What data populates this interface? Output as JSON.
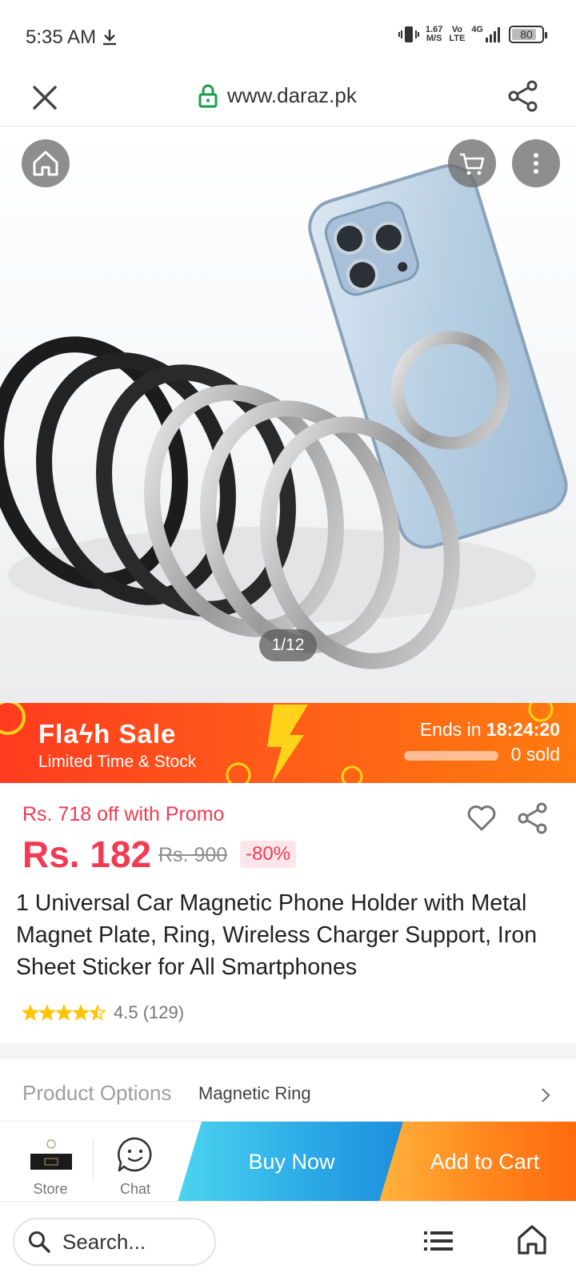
{
  "status_bar": {
    "time": "5:35 AM",
    "net_speed_value": "1.67",
    "net_speed_unit": "M/S",
    "volte_top": "Vo",
    "volte_bottom": "LTE",
    "network": "4G",
    "battery": "80",
    "icons": [
      "download-icon",
      "vibrate-icon",
      "signal-icon",
      "battery-icon"
    ]
  },
  "url_bar": {
    "url": "www.daraz.pk",
    "icons": [
      "close-icon",
      "lock-icon",
      "share-icon"
    ],
    "lock_color": "#1e9e4a"
  },
  "gallery": {
    "counter": "1/12",
    "icons": [
      "home-icon",
      "cart-icon",
      "more-vertical-icon"
    ]
  },
  "flash_sale": {
    "title": "Flaϟh Sale",
    "subtitle": "Limited Time & Stock",
    "ends_label": "Ends in",
    "ends_time": "18:24:20",
    "sold": "0 sold",
    "sold_progress": 0
  },
  "pricing": {
    "promo": "Rs. 718 off with Promo",
    "price": "Rs. 182",
    "original_price": "Rs. 900",
    "discount": "-80%",
    "accent_color": "#f23b53"
  },
  "product": {
    "title": "1 Universal Car Magnetic Phone Holder with Metal Magnet Plate, Ring, Wireless Charger Support, Iron Sheet Sticker for All Smartphones",
    "rating_value": 4.5,
    "rating_text": "4.5 (129)",
    "rating_count": "129"
  },
  "options": {
    "label": "Product Options",
    "value": "Magnetic Ring"
  },
  "action_bar": {
    "store_label": "Store",
    "chat_label": "Chat",
    "buy_now": "Buy Now",
    "add_to_cart": "Add to Cart"
  },
  "browser_bar": {
    "search_placeholder": "Search...",
    "icons": [
      "search-icon",
      "list-icon",
      "home-icon"
    ]
  }
}
